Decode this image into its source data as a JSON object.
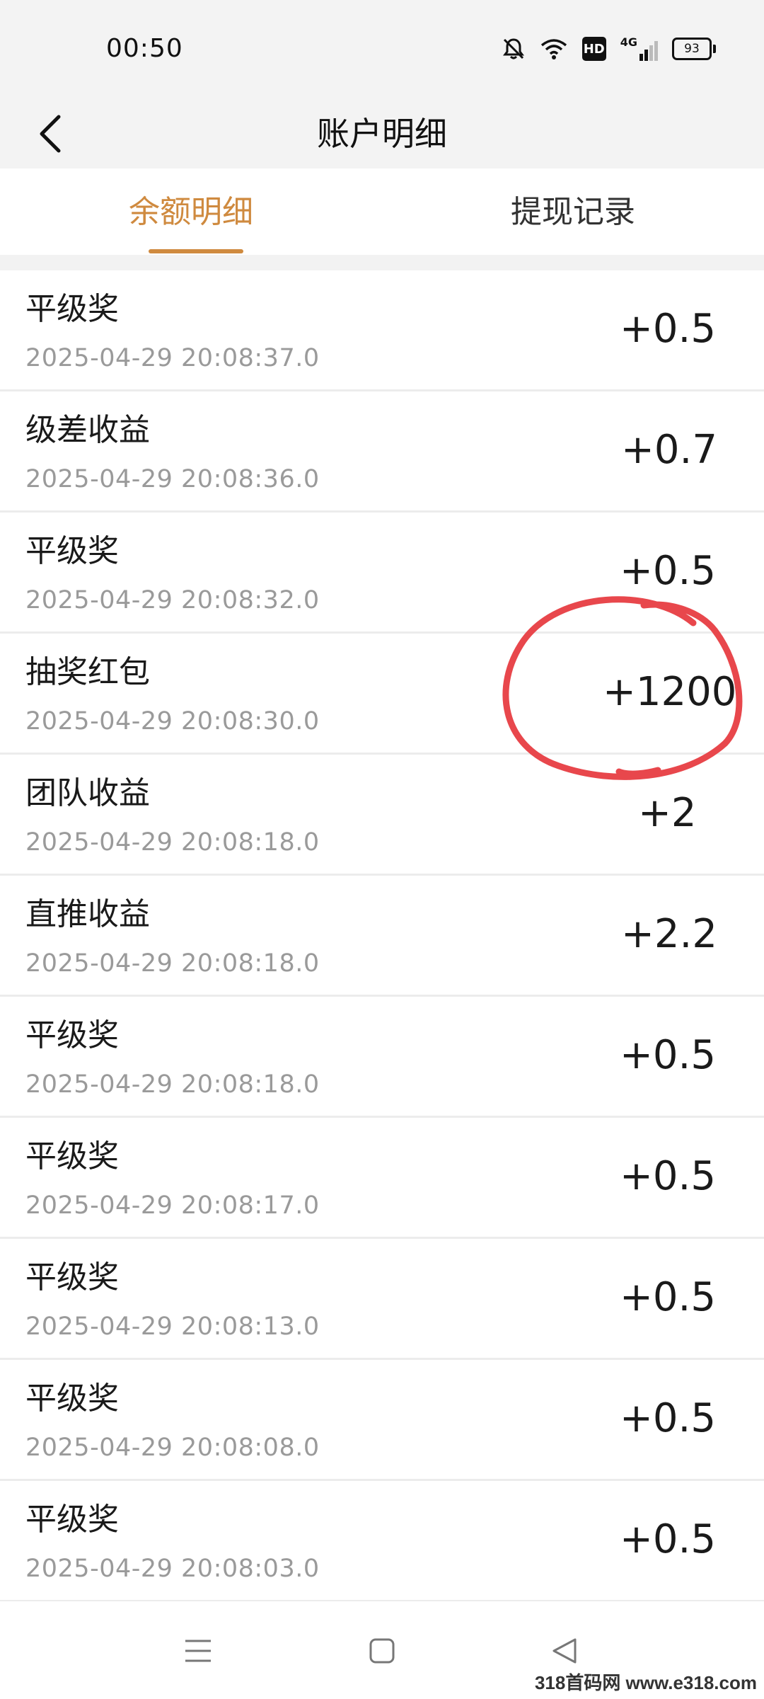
{
  "status_bar": {
    "time": "00:50",
    "network_label": "4G",
    "hd_label": "HD",
    "battery": "93"
  },
  "header": {
    "title": "账户明细"
  },
  "tabs": [
    {
      "label": "余额明细",
      "active": true
    },
    {
      "label": "提现记录",
      "active": false
    }
  ],
  "records": [
    {
      "name": "平级奖",
      "time": "2025-04-29 20:08:37.0",
      "amount": "+0.5"
    },
    {
      "name": "级差收益",
      "time": "2025-04-29 20:08:36.0",
      "amount": "+0.7"
    },
    {
      "name": "平级奖",
      "time": "2025-04-29 20:08:32.0",
      "amount": "+0.5"
    },
    {
      "name": "抽奖红包",
      "time": "2025-04-29 20:08:30.0",
      "amount": "+1200",
      "highlighted": true
    },
    {
      "name": "团队收益",
      "time": "2025-04-29 20:08:18.0",
      "amount": "+2"
    },
    {
      "name": "直推收益",
      "time": "2025-04-29 20:08:18.0",
      "amount": "+2.2"
    },
    {
      "name": "平级奖",
      "time": "2025-04-29 20:08:18.0",
      "amount": "+0.5"
    },
    {
      "name": "平级奖",
      "time": "2025-04-29 20:08:17.0",
      "amount": "+0.5"
    },
    {
      "name": "平级奖",
      "time": "2025-04-29 20:08:13.0",
      "amount": "+0.5"
    },
    {
      "name": "平级奖",
      "time": "2025-04-29 20:08:08.0",
      "amount": "+0.5"
    },
    {
      "name": "平级奖",
      "time": "2025-04-29 20:08:03.0",
      "amount": "+0.5"
    }
  ],
  "nav": {
    "menu_icon": "menu-icon",
    "home_icon": "square-home-icon",
    "back_icon": "triangle-back-icon"
  },
  "watermark": "318首码网 www.e318.com",
  "colors": {
    "accent": "#cf8a3f",
    "annotation": "#e8474c",
    "secondary_text": "#9a9a9a"
  }
}
